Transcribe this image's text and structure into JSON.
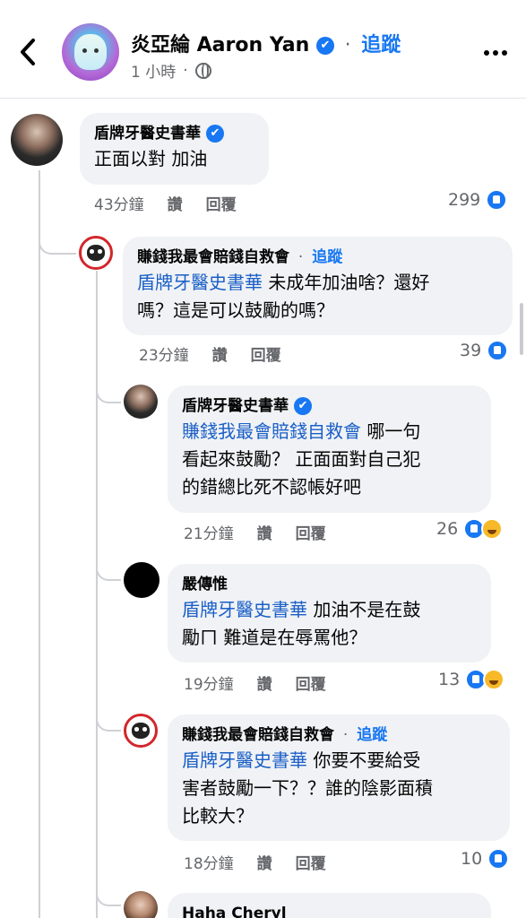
{
  "header": {
    "page_name": "炎亞綸 Aaron Yan",
    "dot": "·",
    "follow": "追蹤",
    "time": "1 小時",
    "verified_mark": "✔"
  },
  "comments": [
    {
      "name": "盾牌牙醫史書華",
      "text": "正面以對 加油",
      "time": "43分鐘",
      "like_label": "讚",
      "reply_label": "回覆",
      "reactions": "299"
    },
    {
      "name": "賺錢我最會賠錢自救會",
      "follow": "追蹤",
      "mention": "盾牌牙醫史書華",
      "text_line1": " 未成年加油啥？還好",
      "text_line2": "嗎？這是可以鼓勵的嗎？",
      "time": "23分鐘",
      "like_label": "讚",
      "reply_label": "回覆",
      "reactions": "39"
    },
    {
      "name": "盾牌牙醫史書華",
      "mention": "賺錢我最會賠錢自救會",
      "text_line1": " 哪一句",
      "text_line2": "看起來鼓勵？ 正面面對自己犯",
      "text_line3": "的錯總比死不認帳好吧",
      "time": "21分鐘",
      "like_label": "讚",
      "reply_label": "回覆",
      "reactions": "26"
    },
    {
      "name": "嚴傳惟",
      "mention": "盾牌牙醫史書華",
      "text_line1": " 加油不是在鼓",
      "text_line2": "勵ㄇ 難道是在辱罵他？",
      "time": "19分鐘",
      "like_label": "讚",
      "reply_label": "回覆",
      "reactions": "13"
    },
    {
      "name": "賺錢我最會賠錢自救會",
      "follow": "追蹤",
      "mention": "盾牌牙醫史書華",
      "text_line1": " 你要不要給受",
      "text_line2": "害者鼓勵一下？？誰的陰影面積",
      "text_line3": "比較大？",
      "time": "18分鐘",
      "like_label": "讚",
      "reply_label": "回覆",
      "reactions": "10"
    },
    {
      "name": "Haha Cheryl"
    }
  ],
  "colors": {
    "facebook_blue": "#1877f2",
    "mention_blue": "#1a5fc7",
    "bubble_bg": "#f0f2f5",
    "meta_gray": "#65676b"
  },
  "icons": [
    "back-arrow-icon",
    "verified-icon",
    "globe-icon",
    "more-icon",
    "like-reaction-icon",
    "haha-reaction-icon"
  ]
}
